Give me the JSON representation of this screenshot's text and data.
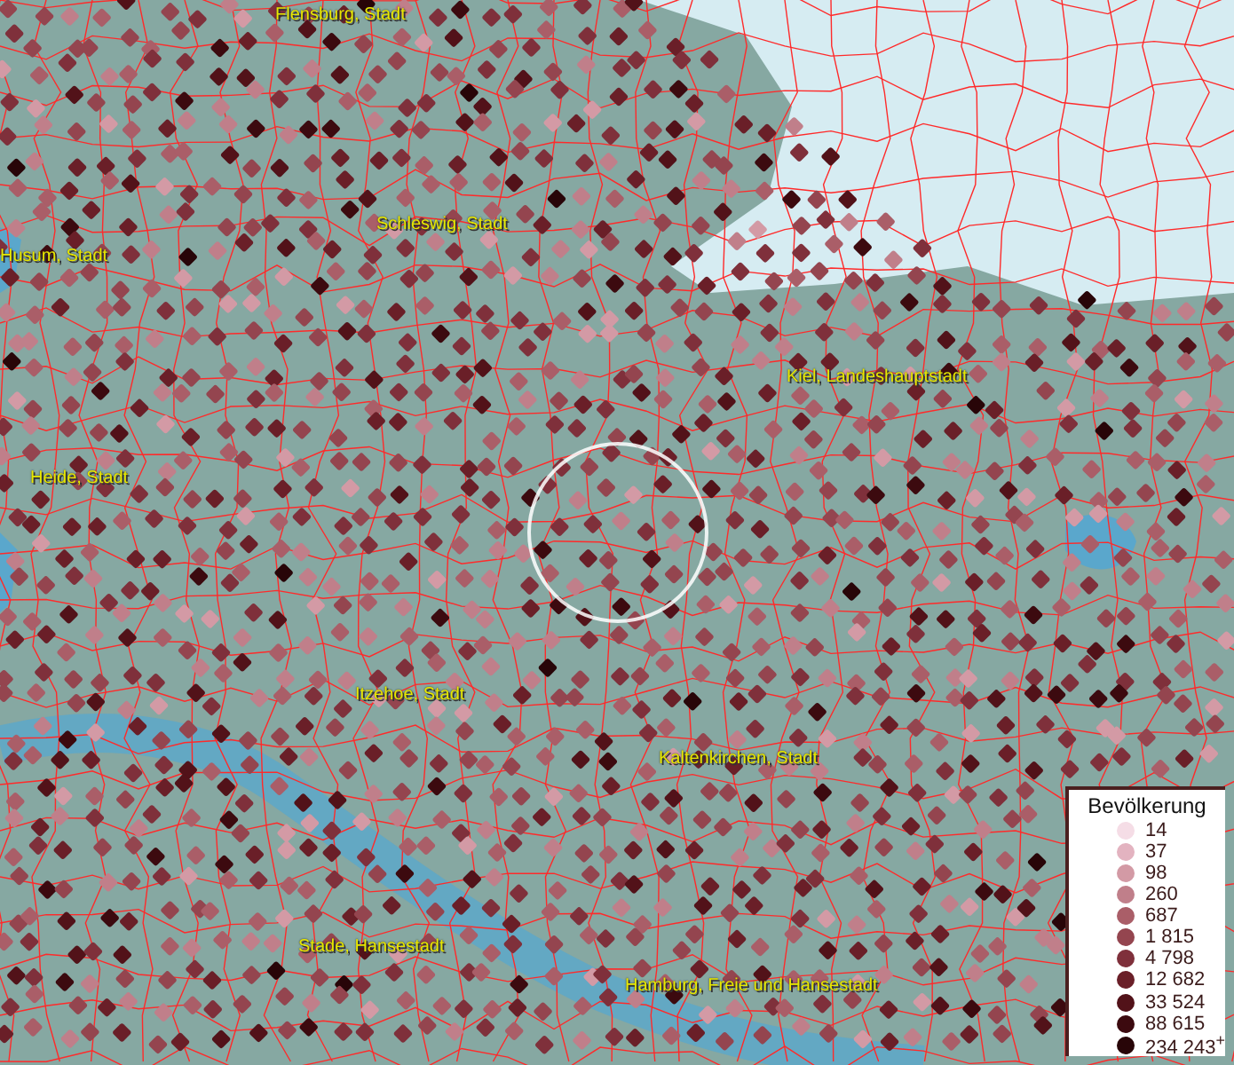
{
  "map": {
    "places": [
      {
        "name": "Flensburg, Stadt"
      },
      {
        "name": "Schleswig, Stadt"
      },
      {
        "name": "Husum, Stadt"
      },
      {
        "name": "Kiel, Landeshauptstadt"
      },
      {
        "name": "Heide, Stadt"
      },
      {
        "name": "Itzehoe, Stadt"
      },
      {
        "name": "Kaltenkirchen, Stadt"
      },
      {
        "name": "Stade, Hansestadt"
      },
      {
        "name": "Hamburg, Freie und Hansestadt"
      }
    ]
  },
  "legend": {
    "title": "Bevölkerung",
    "items": [
      {
        "label": "14",
        "color": "#f5dde6"
      },
      {
        "label": "37",
        "color": "#e3b3c0"
      },
      {
        "label": "98",
        "color": "#d39aa5"
      },
      {
        "label": "260",
        "color": "#c07f8a"
      },
      {
        "label": "687",
        "color": "#aa5e68"
      },
      {
        "label": "1 815",
        "color": "#94454f"
      },
      {
        "label": "4 798",
        "color": "#7f303b"
      },
      {
        "label": "12 682",
        "color": "#6a1f28"
      },
      {
        "label": "33 524",
        "color": "#521219"
      },
      {
        "label": "88 615",
        "color": "#3c0a0f"
      },
      {
        "label": "234 243$^{+}$",
        "color": "#280508"
      }
    ]
  }
}
